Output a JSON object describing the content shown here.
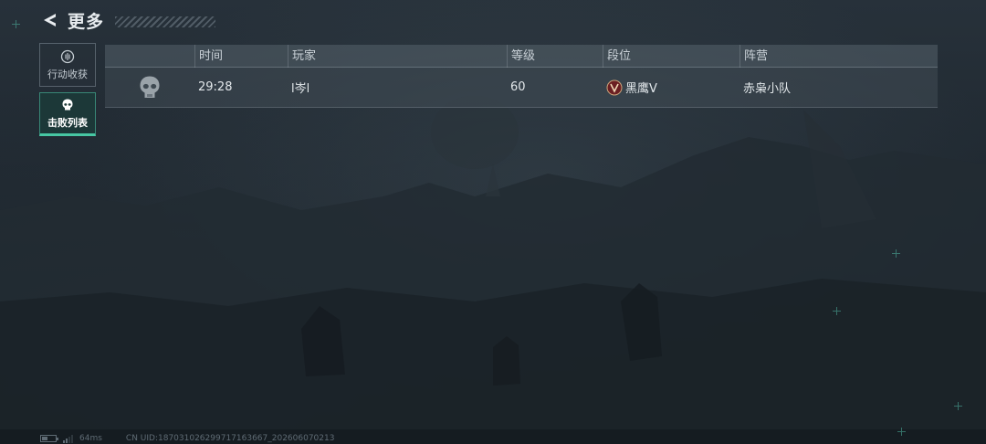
{
  "header": {
    "title": "更多",
    "back_icon": "back-arrow-icon"
  },
  "sidebar": {
    "items": [
      {
        "label": "行动收获",
        "icon": "coin-icon",
        "active": false
      },
      {
        "label": "击败列表",
        "icon": "skull-icon",
        "active": true
      }
    ]
  },
  "table": {
    "columns": [
      "",
      "时间",
      "玩家",
      "等级",
      "段位",
      "阵营"
    ],
    "rows": [
      {
        "icon": "skull-icon",
        "time": "29:28",
        "player": "l岑l",
        "level": "60",
        "rank_icon": "rank-badge-icon",
        "rank": "黑鹰V",
        "faction": "赤枭小队"
      }
    ]
  },
  "footer": {
    "battery_level": 0.4,
    "signal_bars": 2,
    "ping": "64ms",
    "uid": "CN UID:18703102629971716366​7_20260607021​3"
  },
  "colors": {
    "accent": "#47c7a3",
    "background": "#1e262d",
    "rank_badge": "#9a2a2a"
  }
}
